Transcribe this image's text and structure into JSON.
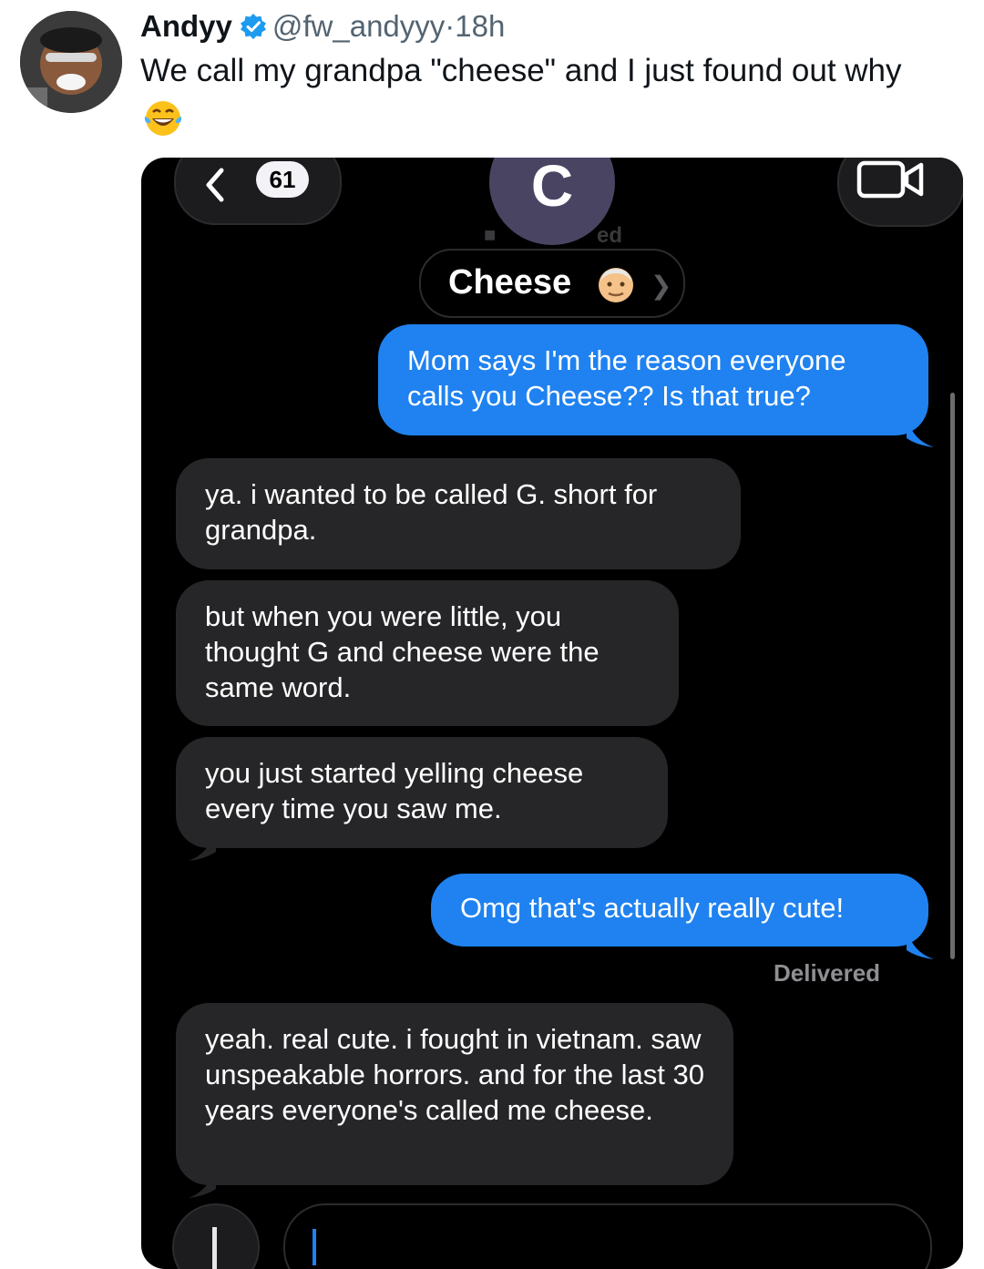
{
  "tweet": {
    "name": "Andyy",
    "handle": "@fw_andyyy",
    "separator": "·",
    "time": "18h",
    "text": "We call my grandpa \"cheese\" and I just found out why",
    "emoji": "tears-of-joy-emoji",
    "verified_color": "#1d9bf0"
  },
  "screenshot": {
    "back_count": "61",
    "contact_initial": "C",
    "contact_name": "Cheese",
    "contact_emoji": "old-man-emoji",
    "ghost_text": "ed",
    "messages": [
      {
        "side": "outgoing",
        "text": "Mom says I'm the reason everyone calls you Cheese?? Is that true?"
      },
      {
        "side": "incoming",
        "text": "ya. i wanted to be called G. short for grandpa."
      },
      {
        "side": "incoming",
        "text": "but when you were little, you thought G and cheese were the same word."
      },
      {
        "side": "incoming",
        "text": "you just started yelling cheese every time you saw me."
      },
      {
        "side": "outgoing",
        "text": "Omg that's actually really cute!"
      },
      {
        "side": "incoming",
        "text": "yeah. real cute. i fought in vietnam. saw unspeakable horrors. and for the last 30 years everyone's called me cheese."
      }
    ],
    "status": "Delivered",
    "colors": {
      "outgoing": "#1f82f0",
      "incoming": "#262628",
      "background": "#000000"
    }
  }
}
